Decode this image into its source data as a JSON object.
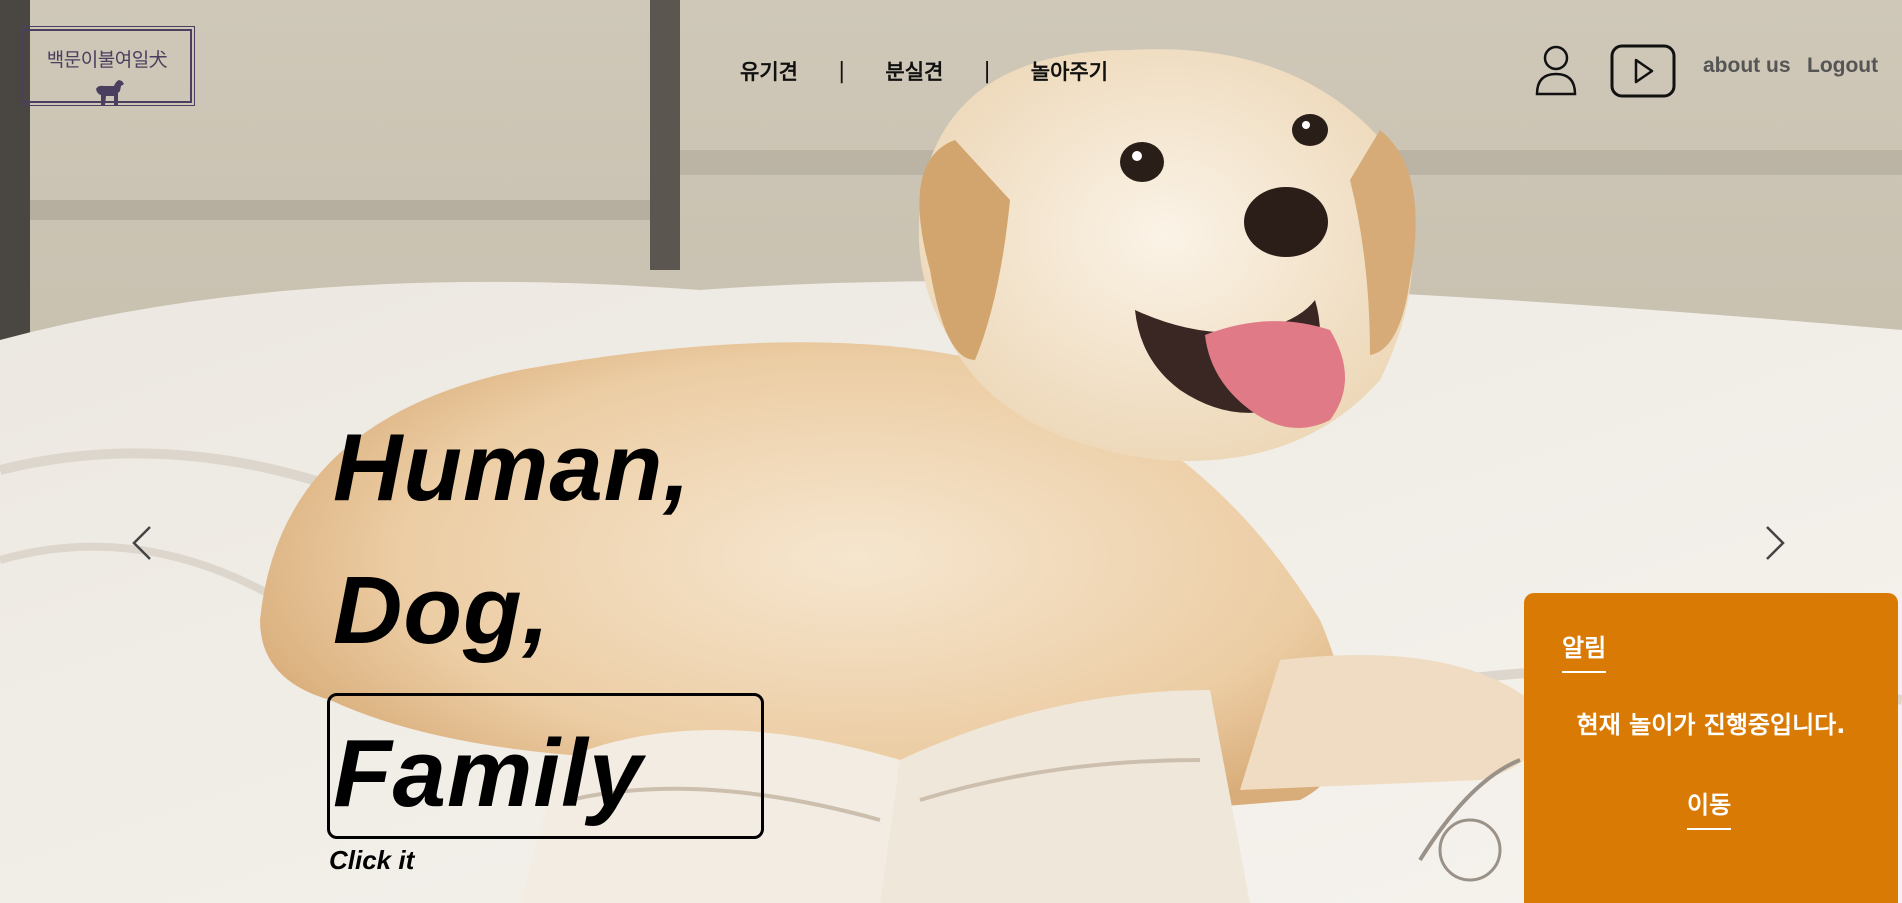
{
  "header": {
    "logo_text": "백문이불여일犬",
    "nav": [
      "유기견",
      "분실견",
      "놀아주기"
    ],
    "separator": "|",
    "about": "about us",
    "logout": "Logout"
  },
  "hero": {
    "line1": "Human,",
    "line2": "Dog,",
    "line3": "Family",
    "cta": "Click it"
  },
  "notice": {
    "title": "알림",
    "message": "현재 놀이가 진행중입니다.",
    "link": "이동"
  },
  "colors": {
    "notice_bg": "#d97a04",
    "logo_color": "#4a3f5e"
  },
  "icons": [
    "user-icon",
    "play-icon",
    "chevron-left-icon",
    "chevron-right-icon",
    "dog-icon"
  ]
}
